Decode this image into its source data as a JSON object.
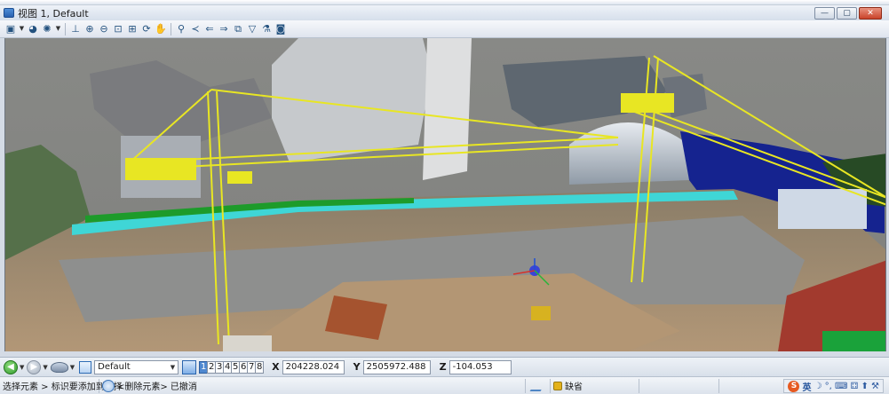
{
  "window": {
    "title": "视图 1, Default",
    "buttons": {
      "minimize": "—",
      "maximize": "▢",
      "close": "✕"
    }
  },
  "toolbar": {
    "tools": [
      {
        "name": "view-attributes-icon",
        "glyph": "▣"
      },
      {
        "name": "display-style-icon",
        "glyph": "◕"
      },
      {
        "name": "lighting-icon",
        "glyph": "✺"
      },
      {
        "name": "camera-icon",
        "glyph": "⊥"
      },
      {
        "name": "zoom-in-icon",
        "glyph": "⊕"
      },
      {
        "name": "zoom-out-icon",
        "glyph": "⊖"
      },
      {
        "name": "window-area-icon",
        "glyph": "⊡"
      },
      {
        "name": "fit-view-icon",
        "glyph": "⊞"
      },
      {
        "name": "rotate-view-icon",
        "glyph": "⟳"
      },
      {
        "name": "pan-view-icon",
        "glyph": "✋"
      },
      {
        "name": "walk-icon",
        "glyph": "⚲"
      },
      {
        "name": "fly-icon",
        "glyph": "≺"
      },
      {
        "name": "view-previous-icon",
        "glyph": "⇐"
      },
      {
        "name": "view-next-icon",
        "glyph": "⇒"
      },
      {
        "name": "copy-view-icon",
        "glyph": "⧉"
      },
      {
        "name": "clip-volume-icon",
        "glyph": "▽"
      },
      {
        "name": "clip-mask-icon",
        "glyph": "⚗"
      },
      {
        "name": "toggle-camera-icon",
        "glyph": "◙"
      }
    ]
  },
  "navigation": {
    "back_glyph": "◀",
    "forward_glyph": "▶",
    "active_view_name": "Default",
    "view_numbers": [
      "1",
      "2",
      "3",
      "4",
      "5",
      "6",
      "7",
      "8"
    ],
    "active_view_index": 0
  },
  "coordinates": {
    "x_label": "X",
    "x_value": "204228.024",
    "y_label": "Y",
    "y_value": "2505972.488",
    "z_label": "Z",
    "z_value": "-104.053"
  },
  "status": {
    "prompt": "选择元素 > 标识要添加到选择",
    "message": "<删除元素> 已撤消",
    "level": "缺省"
  },
  "ime": {
    "logo": "S",
    "lang": "英",
    "glyphs": "☽ °, ⌨ ⚃ ⬆ ⚒"
  },
  "colors": {
    "crane": "#e8e623",
    "fence": "#3fd6d6",
    "sky": "#8b8c89",
    "window_close": "#c9432a"
  }
}
